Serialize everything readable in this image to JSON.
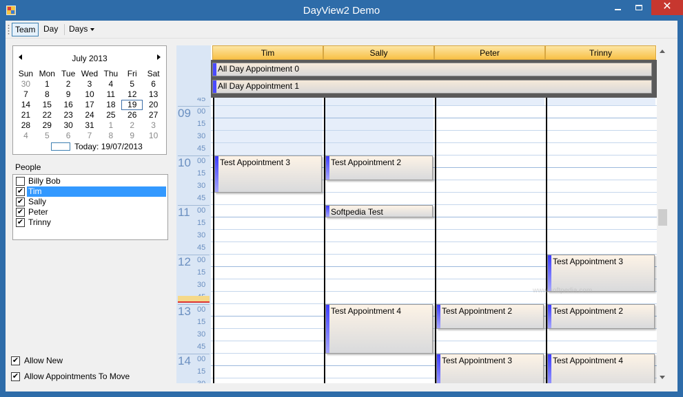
{
  "window": {
    "title": "DayView2 Demo",
    "close_glyph": "✕"
  },
  "toolbar": {
    "team": "Team",
    "day": "Day",
    "days": "Days"
  },
  "calendar": {
    "month_title": "July 2013",
    "weekdays": [
      "Sun",
      "Mon",
      "Tue",
      "Wed",
      "Thu",
      "Fri",
      "Sat"
    ],
    "weeks": [
      [
        "30",
        "1",
        "2",
        "3",
        "4",
        "5",
        "6"
      ],
      [
        "7",
        "8",
        "9",
        "10",
        "11",
        "12",
        "13"
      ],
      [
        "14",
        "15",
        "16",
        "17",
        "18",
        "19",
        "20"
      ],
      [
        "21",
        "22",
        "23",
        "24",
        "25",
        "26",
        "27"
      ],
      [
        "28",
        "29",
        "30",
        "31",
        "1",
        "2",
        "3"
      ],
      [
        "4",
        "5",
        "6",
        "7",
        "8",
        "9",
        "10"
      ]
    ],
    "selected_day": "19",
    "today_text": "Today: 19/07/2013"
  },
  "people": {
    "label": "People",
    "items": [
      {
        "name": "Billy Bob",
        "checked": false,
        "check": ""
      },
      {
        "name": "Tim",
        "checked": true,
        "check": "✔"
      },
      {
        "name": "Sally",
        "checked": true,
        "check": "✔"
      },
      {
        "name": "Peter",
        "checked": true,
        "check": "✔"
      },
      {
        "name": "Trinny",
        "checked": true,
        "check": "✔"
      }
    ]
  },
  "options": {
    "allow_new": "Allow New",
    "allow_move": "Allow Appointments To Move",
    "check": "✔"
  },
  "dayview": {
    "columns": [
      "Tim",
      "Sally",
      "Peter",
      "Trinny"
    ],
    "all_day": [
      "All Day Appointment 0",
      "All Day Appointment 1"
    ],
    "times": [
      {
        "hour": "",
        "min": "45"
      },
      {
        "hour": "09",
        "min": "00"
      },
      {
        "hour": "",
        "min": "15"
      },
      {
        "hour": "",
        "min": "30"
      },
      {
        "hour": "",
        "min": "45"
      },
      {
        "hour": "10",
        "min": "00"
      },
      {
        "hour": "",
        "min": "15"
      },
      {
        "hour": "",
        "min": "30"
      },
      {
        "hour": "",
        "min": "45"
      },
      {
        "hour": "11",
        "min": "00"
      },
      {
        "hour": "",
        "min": "15"
      },
      {
        "hour": "",
        "min": "30"
      },
      {
        "hour": "",
        "min": "45"
      },
      {
        "hour": "12",
        "min": "00"
      },
      {
        "hour": "",
        "min": "15"
      },
      {
        "hour": "",
        "min": "30"
      },
      {
        "hour": "",
        "min": "45"
      },
      {
        "hour": "13",
        "min": "00"
      },
      {
        "hour": "",
        "min": "15"
      },
      {
        "hour": "",
        "min": "30"
      },
      {
        "hour": "",
        "min": "45"
      },
      {
        "hour": "14",
        "min": "00"
      },
      {
        "hour": "",
        "min": "15"
      },
      {
        "hour": "",
        "min": "30"
      }
    ],
    "appointments": [
      {
        "label": "Test Appointment 3",
        "column": "Tim",
        "start": "10:00",
        "end": "10:45"
      },
      {
        "label": "Test Appointment 2",
        "column": "Sally",
        "start": "10:00",
        "end": "10:30"
      },
      {
        "label": "Softpedia Test",
        "column": "Sally",
        "start": "11:00",
        "end": "11:15"
      },
      {
        "label": "Test Appointment 3",
        "column": "Trinny",
        "start": "12:00",
        "end": "12:45"
      },
      {
        "label": "Test Appointment 4",
        "column": "Sally",
        "start": "13:00",
        "end": "14:00"
      },
      {
        "label": "Test Appointment 2",
        "column": "Peter",
        "start": "13:00",
        "end": "13:30"
      },
      {
        "label": "Test Appointment 2",
        "column": "Trinny",
        "start": "13:00",
        "end": "13:30"
      },
      {
        "label": "Test Appointment 3",
        "column": "Peter",
        "start": "14:00",
        "end": "14:45"
      },
      {
        "label": "Test Appointment 4",
        "column": "Trinny",
        "start": "14:00",
        "end": "14:45"
      }
    ],
    "watermark": "www.softpedia.com"
  }
}
